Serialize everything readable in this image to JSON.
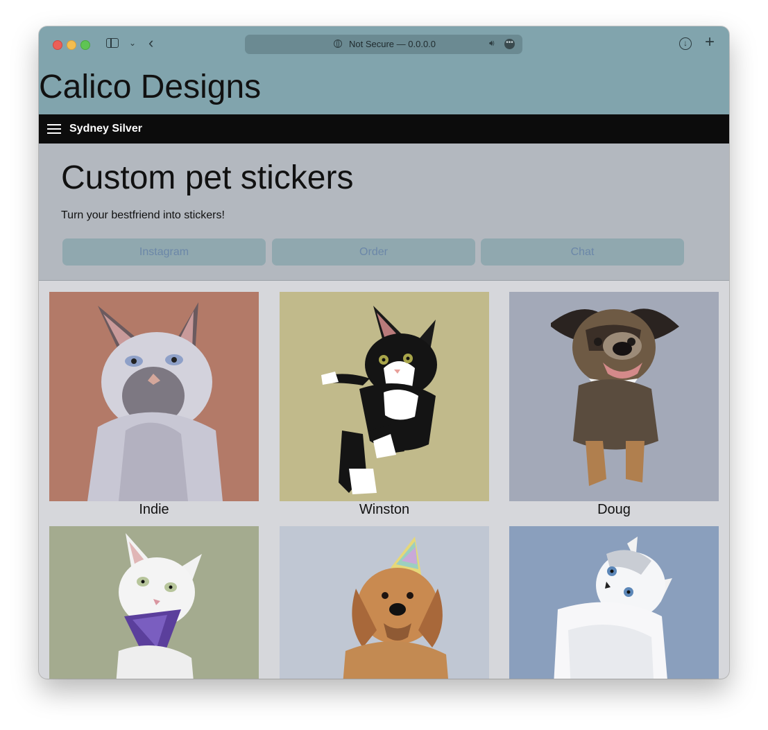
{
  "browser": {
    "url_text": "Not Secure — 0.0.0.0",
    "icons": [
      "sidebar-icon",
      "chevron-down-icon",
      "back-icon",
      "globe-icon",
      "speaker-icon",
      "more-icon",
      "download-icon",
      "plus-icon"
    ]
  },
  "site": {
    "title": "Calico Designs"
  },
  "navbar": {
    "user_name": "Sydney Silver"
  },
  "hero": {
    "title": "Custom pet stickers",
    "subtitle": "Turn your bestfriend into stickers!",
    "buttons": [
      {
        "label": "Instagram"
      },
      {
        "label": "Order"
      },
      {
        "label": "Chat"
      }
    ]
  },
  "pets": [
    {
      "name": "Indie",
      "bg_color": "#b37a68",
      "kind": "siamese-cat"
    },
    {
      "name": "Winston",
      "bg_color": "#c1ba8b",
      "kind": "tuxedo-cat"
    },
    {
      "name": "Doug",
      "bg_color": "#a3a9b8",
      "kind": "dog-with-tie"
    },
    {
      "name": "",
      "bg_color": "#a4ab8f",
      "kind": "white-cat-bandana"
    },
    {
      "name": "",
      "bg_color": "#c0c7d3",
      "kind": "dog-party-hat"
    },
    {
      "name": "",
      "bg_color": "#8a9fbd",
      "kind": "white-fluffy-cat"
    }
  ],
  "colors": {
    "header_bg": "#81a4ad",
    "navbar_bg": "#0c0c0c",
    "hero_bg": "#b3b8bf",
    "button_bg": "#90a8af",
    "button_text": "#6b87a8",
    "page_bg": "#d6d7db"
  }
}
